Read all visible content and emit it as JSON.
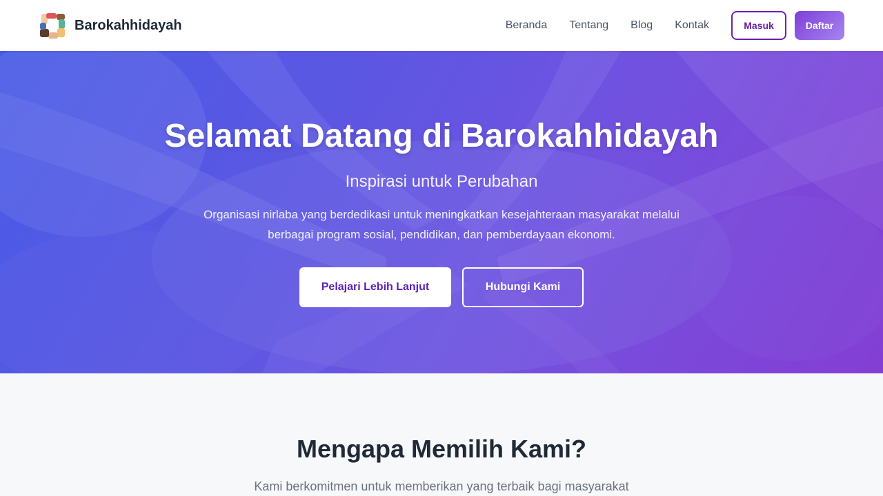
{
  "navbar": {
    "brand_name": "Barokahhidayah",
    "links": [
      "Beranda",
      "Tentang",
      "Blog",
      "Kontak"
    ],
    "login_label": "Masuk",
    "register_label": "Daftar"
  },
  "hero": {
    "title": "Selamat Datang di Barokahhidayah",
    "subtitle": "Inspirasi untuk Perubahan",
    "description": "Organisasi nirlaba yang berdedikasi untuk meningkatkan kesejahteraan masyarakat melalui berbagai program sosial, pendidikan, dan pemberdayaan ekonomi.",
    "primary_button": "Pelajari Lebih Lanjut",
    "secondary_button": "Hubungi Kami"
  },
  "why_section": {
    "title": "Mengapa Memilih Kami?",
    "description": "Kami berkomitmen untuk memberikan yang terbaik bagi masyarakat"
  },
  "colors": {
    "brand_purple": "#6b21a8",
    "hero_gradient_start": "#4c5ee6",
    "hero_gradient_end": "#8742d6",
    "section_bg": "#f7f8fa"
  },
  "icons": {
    "logo": "hands-circle-logo"
  }
}
